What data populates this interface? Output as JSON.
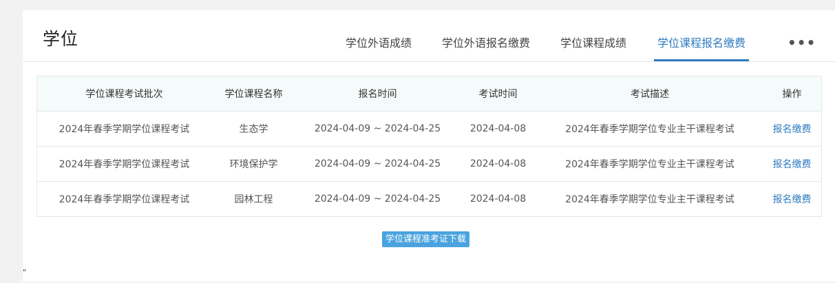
{
  "header": {
    "title": "学位",
    "tabs": [
      {
        "label": "学位外语成绩",
        "active": false
      },
      {
        "label": "学位外语报名缴费",
        "active": false
      },
      {
        "label": "学位课程成绩",
        "active": false
      },
      {
        "label": "学位课程报名缴费",
        "active": true
      }
    ],
    "more_label": "•••"
  },
  "table": {
    "columns": [
      "学位课程考试批次",
      "学位课程名称",
      "报名时间",
      "考试时间",
      "考试描述",
      "操作"
    ],
    "rows": [
      {
        "batch": "2024年春季学期学位课程考试",
        "course": "生态学",
        "reg_time": "2024-04-09 ~ 2024-04-25",
        "exam_time": "2024-04-08",
        "desc": "2024年春季学期学位专业主干课程考试",
        "action": "报名缴费"
      },
      {
        "batch": "2024年春季学期学位课程考试",
        "course": "环境保护学",
        "reg_time": "2024-04-09 ~ 2024-04-25",
        "exam_time": "2024-04-08",
        "desc": "2024年春季学期学位专业主干课程考试",
        "action": "报名缴费"
      },
      {
        "batch": "2024年春季学期学位课程考试",
        "course": "园林工程",
        "reg_time": "2024-04-09 ~ 2024-04-25",
        "exam_time": "2024-04-08",
        "desc": "2024年春季学期学位专业主干课程考试",
        "action": "报名缴费"
      }
    ]
  },
  "download_button": "学位课程准考证下载",
  "stray_mark": "\"",
  "colors": {
    "accent": "#2f7bbf",
    "button_bg": "#4aa3df",
    "header_row_bg": "#f5fafa",
    "page_bg": "#f2f2f2"
  }
}
